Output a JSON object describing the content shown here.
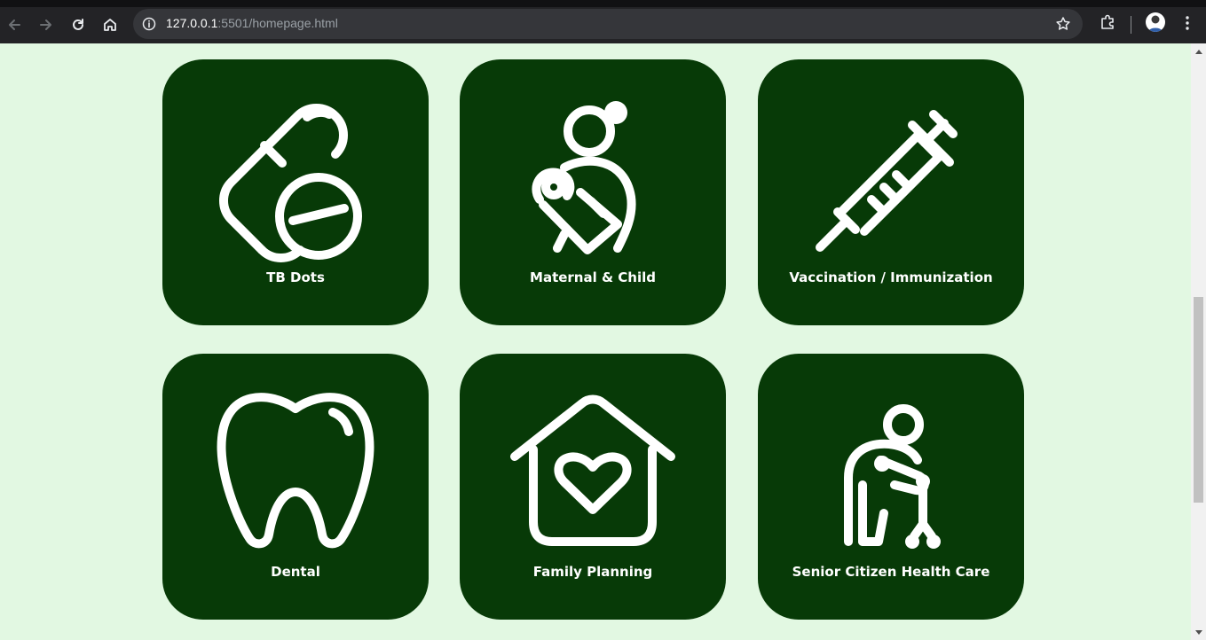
{
  "browser": {
    "url_host": "127.0.0.1",
    "url_port_path": ":5501/homepage.html"
  },
  "services": [
    {
      "label": "TB Dots",
      "icon": "pills-icon"
    },
    {
      "label": "Maternal & Child",
      "icon": "mother-child-icon"
    },
    {
      "label": "Vaccination / Immunization",
      "icon": "syringe-icon"
    },
    {
      "label": "Dental",
      "icon": "tooth-icon"
    },
    {
      "label": "Family Planning",
      "icon": "house-heart-icon"
    },
    {
      "label": "Senior Citizen Health Care",
      "icon": "elderly-walker-icon"
    }
  ],
  "colors": {
    "page_background": "#e2f8e2",
    "card_background": "#073a07",
    "icon_stroke": "#ffffff"
  }
}
